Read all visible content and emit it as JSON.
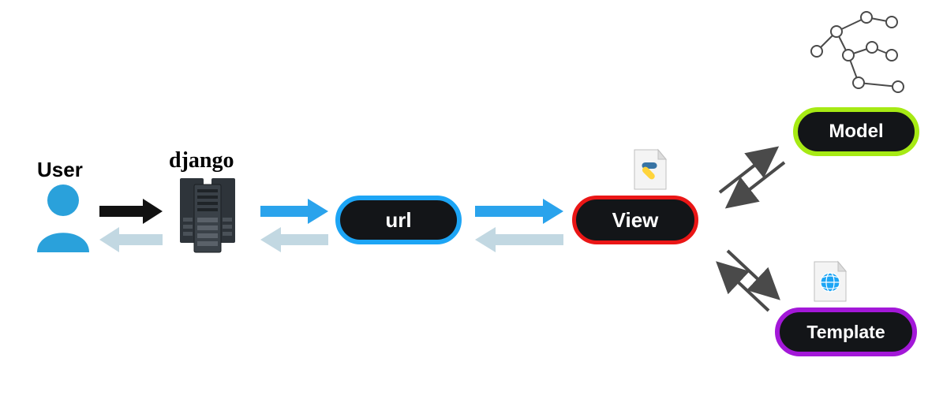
{
  "nodes": {
    "user_label": "User",
    "django_label": "django",
    "url_label": "url",
    "view_label": "View",
    "model_label": "Model",
    "template_label": "Template"
  },
  "colors": {
    "pill_fill": "#131518",
    "user_fill": "#2aa1db",
    "url_border": "#1da5f5",
    "view_border": "#ea1616",
    "model_border": "#a6ea14",
    "template_border": "#a318d8",
    "arrow_blue": "#2aa3ec",
    "arrow_light": "#c2d8e2",
    "arrow_black": "#111111",
    "arrow_grey": "#4a4a4a"
  },
  "icons": {
    "user": "user-icon",
    "server": "server-icon",
    "graph": "graph-icon",
    "python_file": "python-file-icon",
    "globe_file": "globe-file-icon"
  }
}
